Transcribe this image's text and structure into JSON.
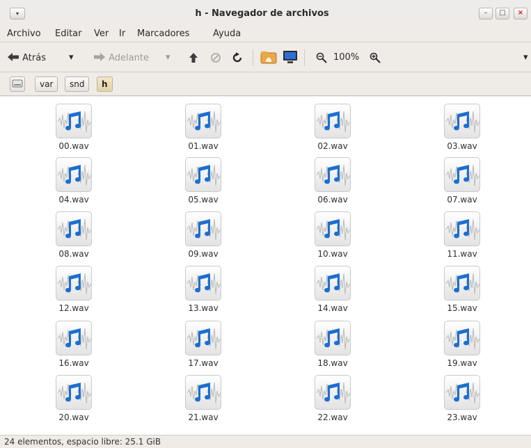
{
  "window": {
    "title": "h - Navegador de archivos",
    "menu_button": "▾",
    "minimize": "–",
    "maximize": "□",
    "close": "×"
  },
  "menubar": {
    "items": [
      "Archivo",
      "Editar",
      "Ver",
      "Ir",
      "Marcadores",
      "Ayuda"
    ]
  },
  "toolbar": {
    "back_label": "Atrás",
    "forward_label": "Adelante",
    "dropdown": "▾",
    "zoom_level": "100%"
  },
  "location": {
    "crumbs": [
      "var",
      "snd",
      "h"
    ],
    "active": "h"
  },
  "files": [
    "00.wav",
    "01.wav",
    "02.wav",
    "03.wav",
    "04.wav",
    "05.wav",
    "06.wav",
    "07.wav",
    "08.wav",
    "09.wav",
    "10.wav",
    "11.wav",
    "12.wav",
    "13.wav",
    "14.wav",
    "15.wav",
    "16.wav",
    "17.wav",
    "18.wav",
    "19.wav",
    "20.wav",
    "21.wav",
    "22.wav",
    "23.wav"
  ],
  "file_icon": "audio-file-icon",
  "colors": {
    "accent_note": "#1c6fd1",
    "window_bg": "#efebe7",
    "close_button": "#dd1111"
  },
  "statusbar": {
    "text": "24 elementos, espacio libre: 25.1 GiB"
  }
}
